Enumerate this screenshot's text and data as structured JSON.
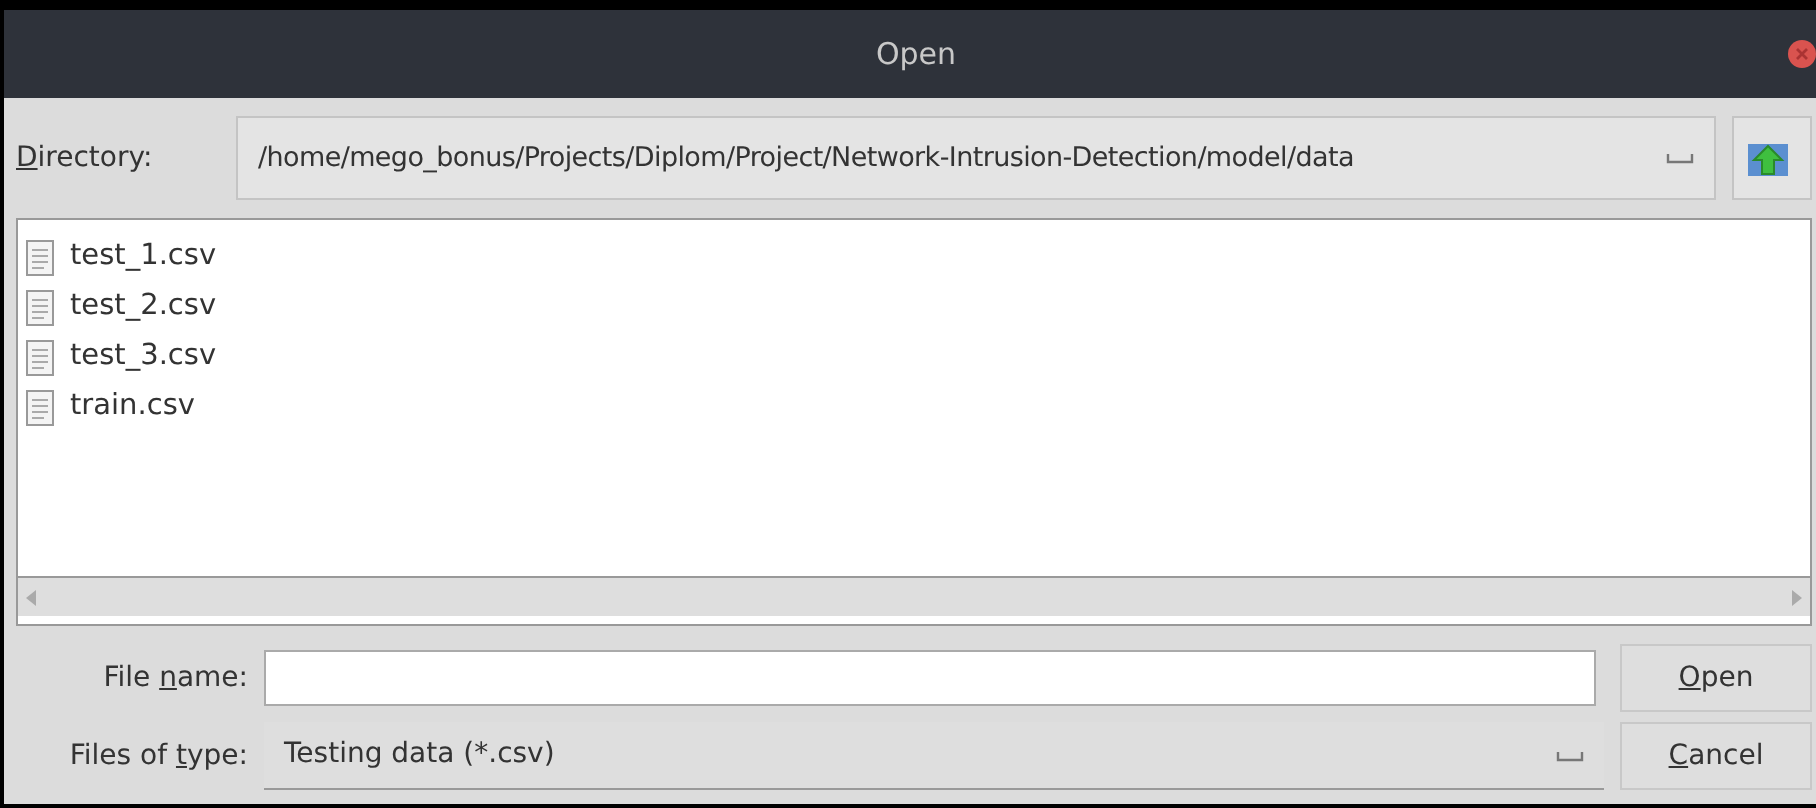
{
  "window": {
    "title": "Open"
  },
  "directory": {
    "access_key": "D",
    "label_after": "irectory:",
    "value": "/home/mego_bonus/Projects/Diplom/Project/Network-Intrusion-Detection/model/data"
  },
  "files": [
    {
      "name": "test_1.csv"
    },
    {
      "name": "test_2.csv"
    },
    {
      "name": "test_3.csv"
    },
    {
      "name": "train.csv"
    }
  ],
  "file_name": {
    "label_before": "File ",
    "access_key": "n",
    "label_after": "ame:"
  },
  "file_type": {
    "label_before": "Files of ",
    "access_key": "t",
    "label_after": "ype:",
    "value": "Testing data (*.csv)"
  },
  "buttons": [
    {
      "access_key": "O",
      "label_after": "pen"
    },
    {
      "access_key": "C",
      "label_after": "ancel"
    }
  ]
}
